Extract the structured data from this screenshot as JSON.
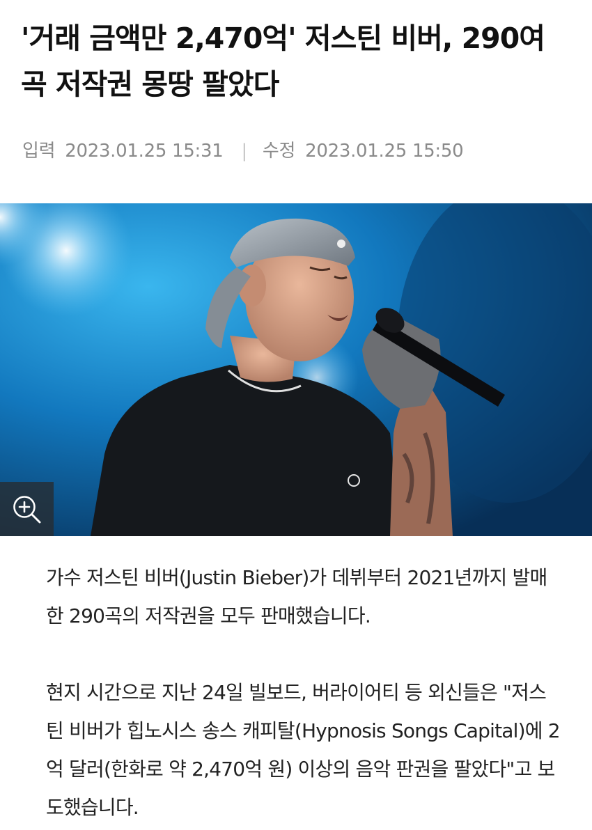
{
  "article": {
    "headline": "'거래 금액만 2,470억' 저스틴 비버, 290여 곡 저작권 몽땅 팔았다",
    "meta": {
      "input_label": "입력",
      "input_time": "2023.01.25 15:31",
      "separator": "|",
      "edit_label": "수정",
      "edit_time": "2023.01.25 15:50"
    },
    "photo": {
      "zoom_icon": "zoom-in-icon"
    },
    "paragraphs": [
      "가수 저스틴 비버(Justin Bieber)가 데뷔부터 2021년까지 발매한 290곡의 저작권을 모두 판매했습니다.",
      "현지 시간으로 지난 24일 빌보드, 버라이어티 등 외신들은 \"저스틴 비버가 힙노시스 송스 캐피탈(Hypnosis Songs Capital)에 2억 달러(한화로 약 2,470억 원) 이상의 음악 판권을 팔았다\"고 보도했습니다."
    ]
  },
  "colors": {
    "headline": "#111111",
    "meta": "#8a8a8a",
    "body": "#222222",
    "stage_blue": "#0f6fb5",
    "zoom_button_bg": "#2c3034"
  }
}
